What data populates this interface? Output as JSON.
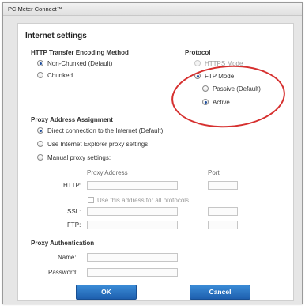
{
  "window": {
    "title": "PC Meter Connect™"
  },
  "dialog": {
    "title": "Internet settings"
  },
  "encoding": {
    "heading": "HTTP Transfer Encoding Method",
    "options": [
      "Non-Chunked (Default)",
      "Chunked"
    ],
    "selected": "Non-Chunked (Default)"
  },
  "protocol": {
    "heading": "Protocol",
    "https_label": "HTTPS Mode",
    "ftp_label": "FTP Mode",
    "passive_label": "Passive (Default)",
    "active_label": "Active",
    "selected": "FTP Mode",
    "ftp_selected": "Active"
  },
  "proxy": {
    "heading": "Proxy Address Assignment",
    "options": [
      "Direct connection to the Internet  (Default)",
      "Use Internet Explorer proxy settings",
      "Manual proxy settings:"
    ],
    "selected": "Direct connection to the Internet  (Default)",
    "address_header": "Proxy Address",
    "port_header": "Port",
    "http_label": "HTTP:",
    "same_address_label": "Use this address for all protocols",
    "ssl_label": "SSL:",
    "ftp_label": "FTP:",
    "http_value": "",
    "http_port": "",
    "ssl_value": "",
    "ssl_port": "",
    "ftp_value": "",
    "ftp_port": ""
  },
  "auth": {
    "heading": "Proxy Authentication",
    "name_label": "Name:",
    "password_label": "Password:",
    "name_value": "",
    "password_value": ""
  },
  "buttons": {
    "ok": "OK",
    "cancel": "Cancel"
  },
  "annotation": {
    "color": "#d6302f",
    "shape": "ellipse around FTP Mode options"
  }
}
